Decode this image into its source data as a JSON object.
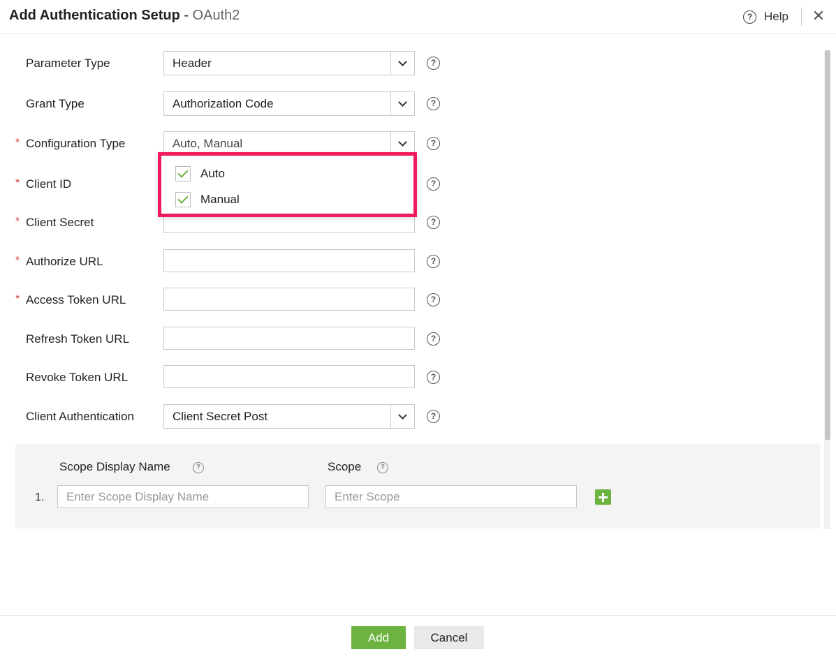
{
  "header": {
    "title": "Add Authentication Setup",
    "separator": "-",
    "subtitle": "OAuth2",
    "help_label": "Help"
  },
  "form": {
    "parameter_type": {
      "label": "Parameter Type",
      "value": "Header"
    },
    "grant_type": {
      "label": "Grant Type",
      "value": "Authorization Code"
    },
    "configuration_type": {
      "label": "Configuration Type",
      "value": "Auto, Manual",
      "required": "*"
    },
    "client_id": {
      "label": "Client ID",
      "required": "*"
    },
    "client_secret": {
      "label": "Client Secret",
      "required": "*"
    },
    "authorize_url": {
      "label": "Authorize URL",
      "required": "*"
    },
    "access_token_url": {
      "label": "Access Token URL",
      "required": "*"
    },
    "refresh_token_url": {
      "label": "Refresh Token URL"
    },
    "revoke_token_url": {
      "label": "Revoke Token URL"
    },
    "client_authentication": {
      "label": "Client Authentication",
      "value": "Client Secret Post"
    }
  },
  "dropdown": {
    "options": [
      {
        "label": "Auto",
        "checked": true
      },
      {
        "label": "Manual",
        "checked": true
      }
    ]
  },
  "scope": {
    "display_name_header": "Scope Display Name",
    "scope_header": "Scope",
    "rows": [
      {
        "number": "1.",
        "display_name_placeholder": "Enter Scope Display Name",
        "scope_placeholder": "Enter Scope"
      }
    ]
  },
  "footer": {
    "add_label": "Add",
    "cancel_label": "Cancel"
  },
  "icons": {
    "help": "question-circle-icon",
    "close": "close-icon",
    "dropdown_arrow": "chevron-down-icon",
    "check": "check-icon",
    "add_row": "plus-icon"
  },
  "colors": {
    "accent_green": "#6cb33f",
    "highlight": "#ef1b5c",
    "required": "#d04040"
  }
}
